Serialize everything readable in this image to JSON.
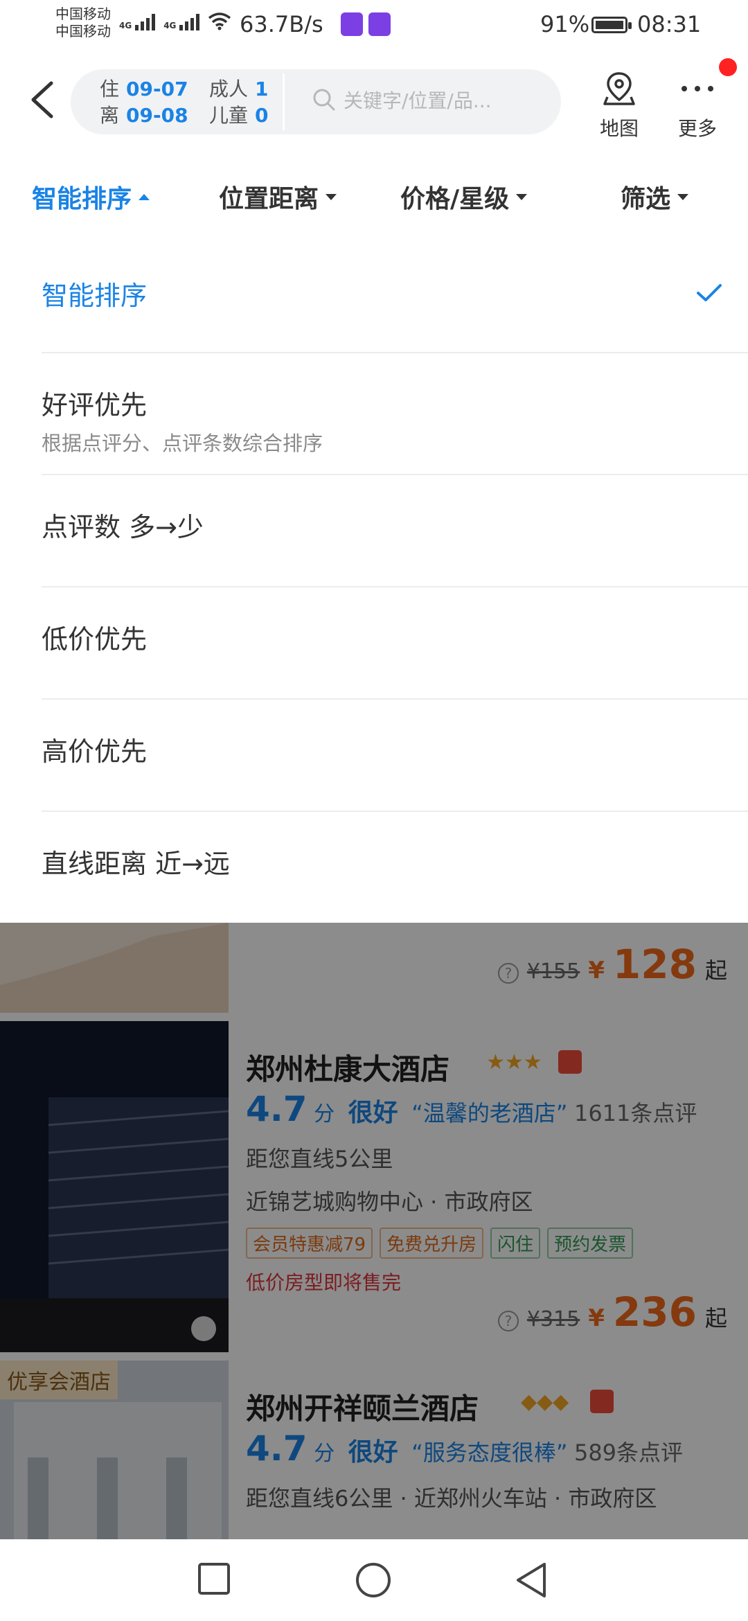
{
  "status_bar": {
    "carrier1": "中国移动",
    "carrier2": "中国移动",
    "net1": "4G",
    "net2": "4G",
    "speed": "63.7B/s",
    "battery": "91%",
    "time": "08:31"
  },
  "header": {
    "checkin_label": "住",
    "checkin_date": "09-07",
    "checkout_label": "离",
    "checkout_date": "09-08",
    "adults_label": "成人",
    "adults": "1",
    "children_label": "儿童",
    "children": "0",
    "search_placeholder": "关键字/位置/品...",
    "map_label": "地图",
    "more_label": "更多"
  },
  "tabs": [
    {
      "label": "智能排序",
      "active": true
    },
    {
      "label": "位置距离"
    },
    {
      "label": "价格/星级"
    },
    {
      "label": "筛选"
    }
  ],
  "sort_options": [
    {
      "label": "智能排序",
      "selected": true
    },
    {
      "label": "好评优先",
      "sub": "根据点评分、点评条数综合排序"
    },
    {
      "label": "点评数  多→少"
    },
    {
      "label": "低价优先"
    },
    {
      "label": "高价优先"
    },
    {
      "label": "直线距离  近→远"
    }
  ],
  "hotels": [
    {
      "old_price": "¥155",
      "currency": "¥",
      "price": "128",
      "price_suffix": "起"
    },
    {
      "name": "郑州杜康大酒店",
      "stars": "★★★",
      "score": "4.7",
      "score_unit": "分",
      "rating_word": "很好",
      "quote": "“温馨的老酒店”",
      "reviews": "1611条点评",
      "distance": "距您直线5公里",
      "location": "近锦艺城购物中心 · 市政府区",
      "tags": [
        "会员特惠减79",
        "免费兑升房",
        "闪住",
        "预约发票"
      ],
      "urgent": "低价房型即将售完",
      "old_price": "¥315",
      "currency": "¥",
      "price": "236",
      "price_suffix": "起"
    },
    {
      "vip": "优享会酒店",
      "name": "郑州开祥颐兰酒店",
      "stars": "◆◆◆",
      "score": "4.7",
      "score_unit": "分",
      "rating_word": "很好",
      "quote": "“服务态度很棒”",
      "reviews": "589条点评",
      "location": "距您直线6公里  · 近郑州火车站 · 市政府区"
    }
  ],
  "colors": {
    "accent": "#1a83e6",
    "price": "#f06a1a",
    "urgent": "#e0333a"
  }
}
